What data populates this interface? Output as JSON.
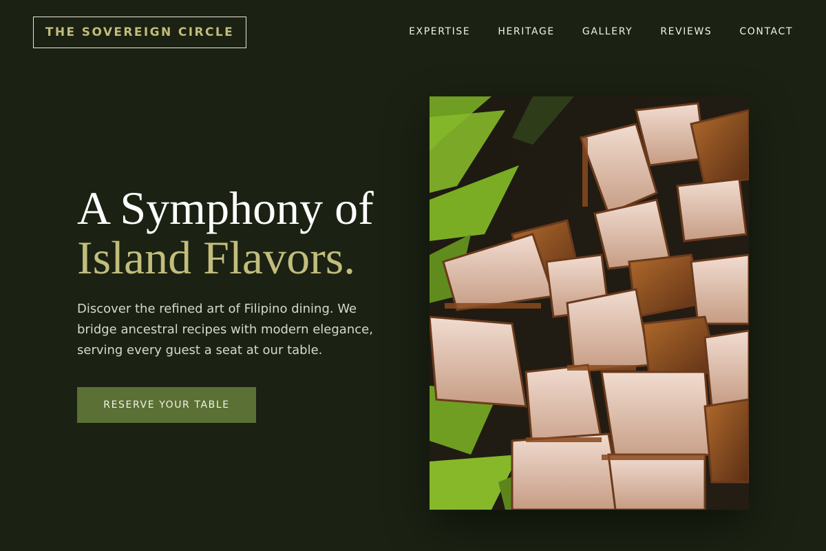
{
  "brand": {
    "name": "THE SOVEREIGN CIRCLE"
  },
  "nav": {
    "items": [
      {
        "label": "EXPERTISE"
      },
      {
        "label": "HERITAGE"
      },
      {
        "label": "GALLERY"
      },
      {
        "label": "REVIEWS"
      },
      {
        "label": "CONTACT"
      }
    ]
  },
  "hero": {
    "title_line1": "A Symphony of",
    "title_line2": "Island Flavors.",
    "description": "Discover the refined art of Filipino dining. We bridge ancestral recipes with modern elegance, serving every guest a seat at our table.",
    "cta_label": "RESERVE YOUR TABLE"
  },
  "colors": {
    "background": "#1b2213",
    "accent_gold": "#c2bd7c",
    "button_green": "#5a7034"
  }
}
